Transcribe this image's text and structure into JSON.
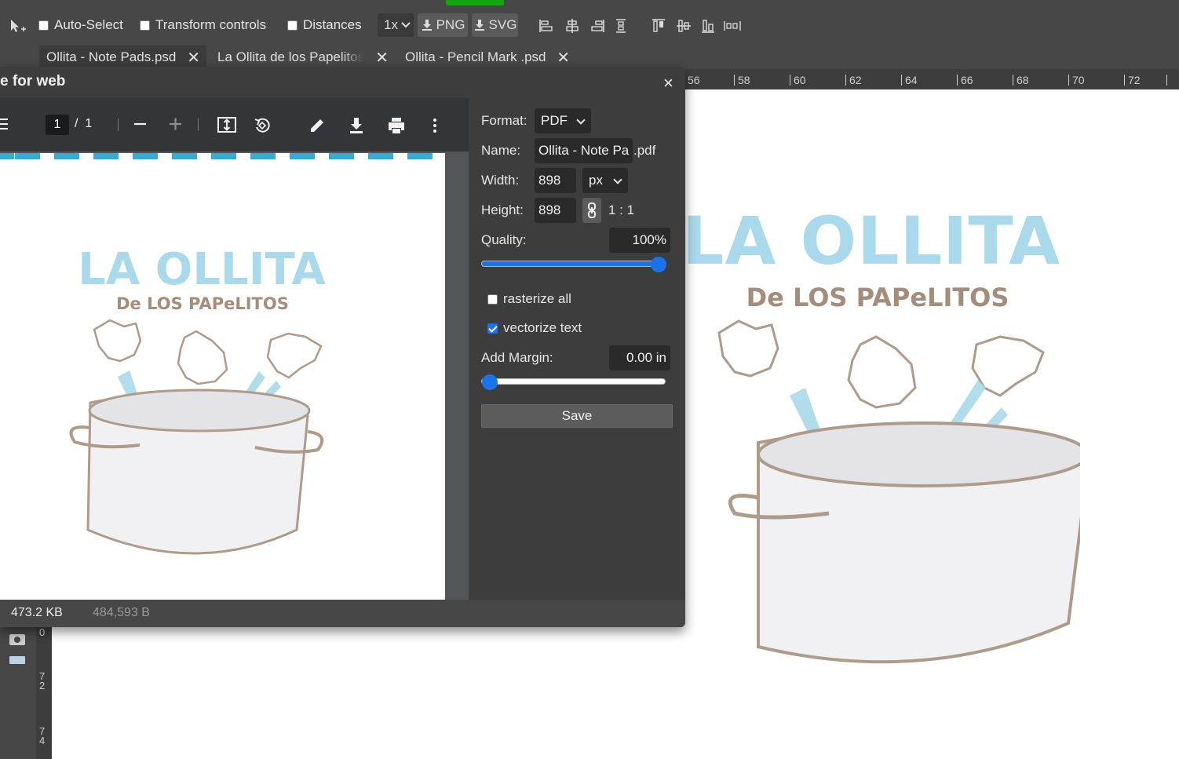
{
  "toolbar": {
    "auto_select": "Auto-Select",
    "transform_controls": "Transform controls",
    "distances": "Distances",
    "zoom": "1x",
    "png": "PNG",
    "svg": "SVG"
  },
  "tabs": [
    {
      "label": "Ollita - Note Pads.psd",
      "active": true
    },
    {
      "label": "La Ollita de los Papelitos"
    },
    {
      "label": "Ollita - Pencil Mark .psd"
    }
  ],
  "ruler": {
    "top": [
      "56",
      "58",
      "60",
      "62",
      "64",
      "66",
      "68",
      "70",
      "72"
    ],
    "left": [
      [
        "0"
      ],
      [
        "7",
        "2"
      ],
      [
        "7",
        "4"
      ]
    ]
  },
  "dialog": {
    "title": "e for web",
    "close": "×",
    "viewer": {
      "page": "1",
      "total": "1"
    },
    "settings": {
      "format_label": "Format:",
      "format_value": "PDF",
      "name_label": "Name:",
      "name_value": "Ollita - Note Pa",
      "name_ext": ".pdf",
      "width_label": "Width:",
      "width_value": "898",
      "unit": "px",
      "height_label": "Height:",
      "height_value": "898",
      "ratio": "1 : 1",
      "quality_label": "Quality:",
      "quality_value": "100%",
      "quality_level": 1.0,
      "rasterize_label": "rasterize all",
      "rasterize_checked": false,
      "vectorize_label": "vectorize text",
      "vectorize_checked": true,
      "margin_label": "Add Margin:",
      "margin_value": "0.00 in",
      "margin_level": 0.0,
      "save": "Save"
    },
    "status": {
      "size_kb": "473.2 KB",
      "size_bytes": "484,593 B"
    }
  },
  "artwork": {
    "title": "LA OLLITA",
    "subtitle": "De LOS PAPeLITOS"
  },
  "colors": {
    "accent": "#1a73e8",
    "title_blue": "#a9d9ea",
    "subtitle_brown": "#a48d7d",
    "pot_outline": "#ad9b8c",
    "stripe_blue": "#3aa9d4",
    "run_green": "#0fa60f"
  }
}
